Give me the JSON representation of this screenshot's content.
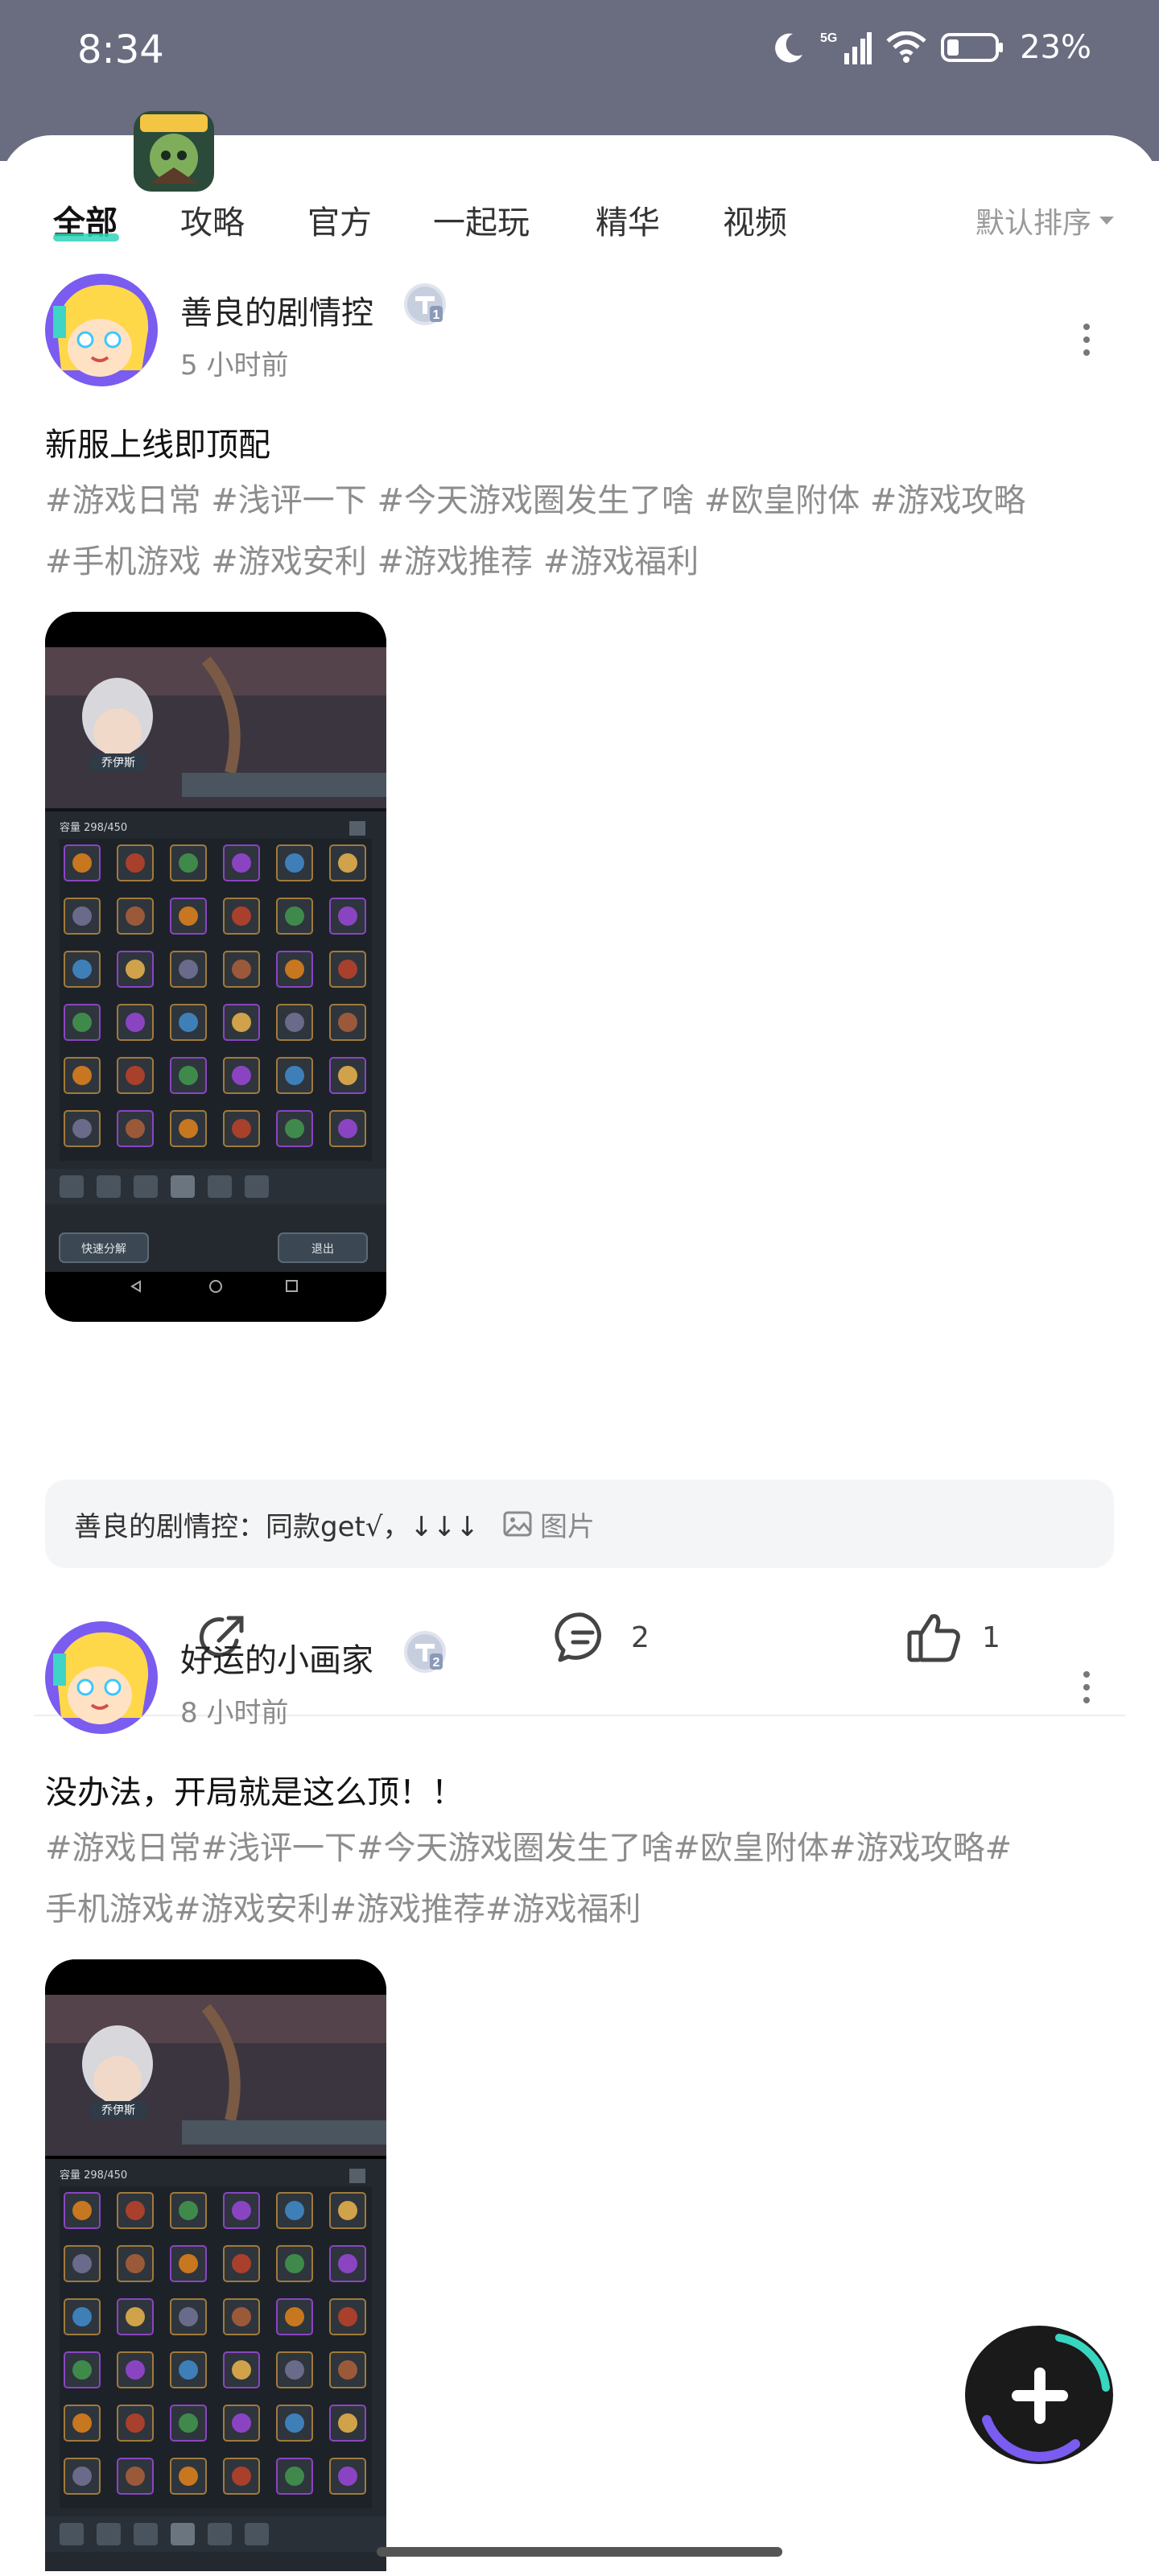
{
  "status_bar": {
    "time": "8:34",
    "network": "5G",
    "battery": "23%"
  },
  "tabs": [
    {
      "label": "全部",
      "active": true
    },
    {
      "label": "攻略",
      "active": false
    },
    {
      "label": "官方",
      "active": false
    },
    {
      "label": "一起玩",
      "active": false
    },
    {
      "label": "精华",
      "active": false
    },
    {
      "label": "视频",
      "active": false
    }
  ],
  "sort": {
    "label": "默认排序"
  },
  "posts": [
    {
      "username": "善良的剧情控",
      "level": "1",
      "time": "5 小时前",
      "title": "新服上线即顶配",
      "tags_line1": "#游戏日常 #浅评一下 #今天游戏圈发生了啥 #欧皇附体 #游戏攻略",
      "tags_line2": "#手机游戏 #游戏安利 #游戏推荐 #游戏福利",
      "comment_preview": "善良的剧情控：同款get√，↓↓↓",
      "comment_image_label": "图片",
      "comment_count": "2",
      "like_count": "1"
    },
    {
      "username": "好运的小画家",
      "level": "2",
      "time": "8 小时前",
      "title": "没办法，开局就是这么顶！！",
      "tags_line1": "#游戏日常#浅评一下#今天游戏圈发生了啥#欧皇附体#游戏攻略#",
      "tags_line2": "手机游戏#游戏安利#游戏推荐#游戏福利"
    }
  ],
  "screenshot_content": {
    "character_name": "乔伊斯",
    "capacity": "容量 298/450",
    "quick_disassemble": "快速分解",
    "exit": "退出"
  },
  "icons": {
    "share": "share-icon",
    "comment": "comment-icon",
    "like": "thumb-up-icon",
    "more": "more-vertical-icon",
    "fab": "plus-icon"
  },
  "colors": {
    "tab_indicator": "#2fd4b8",
    "tag_text": "#8d8d8d",
    "status_bar_bg": "#6a6c80"
  }
}
